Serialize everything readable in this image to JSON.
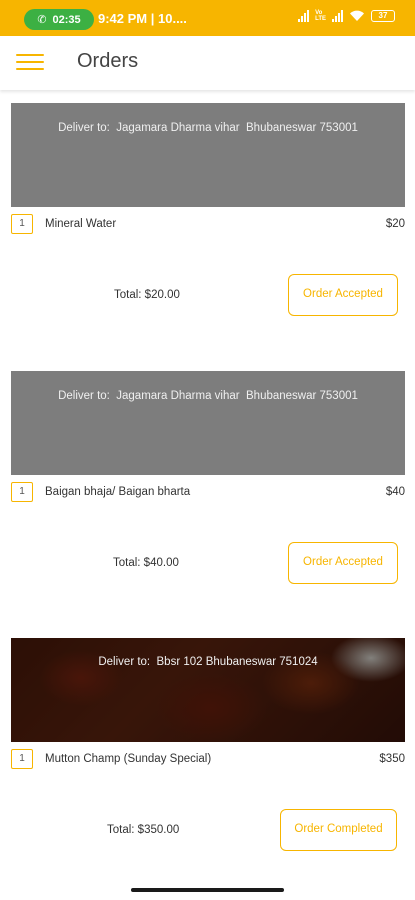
{
  "status_bar": {
    "call_time": "02:35",
    "time": "9:42 PM | 10....",
    "network_label_1": "Vo",
    "network_label_2": "LTE",
    "battery": "37"
  },
  "app_bar": {
    "menu_icon": "hamburger-menu-icon",
    "title": "Orders"
  },
  "orders": [
    {
      "deliver_text": "Deliver to:  Jagamara Dharma vihar  Bhubaneswar 753001",
      "items": [
        {
          "qty": "1",
          "name": "Mineral Water",
          "price": "$20"
        }
      ],
      "total": "Total: $20.00",
      "status": "Order Accepted"
    },
    {
      "deliver_text": "Deliver to:  Jagamara Dharma vihar  Bhubaneswar 753001",
      "items": [
        {
          "qty": "1",
          "name": "Baigan bhaja/ Baigan bharta",
          "price": "$40"
        }
      ],
      "total": "Total: $40.00",
      "status": "Order Accepted"
    },
    {
      "deliver_text": "Deliver to:  Bbsr 102 Bhubaneswar 751024",
      "items": [
        {
          "qty": "1",
          "name": "Mutton Champ (Sunday Special)",
          "price": "$350"
        }
      ],
      "total": "Total: $350.00",
      "status": "Order Completed"
    }
  ],
  "colors": {
    "accent": "#f7b500",
    "call_pill": "#3cb043",
    "banner_gray": "#7d7d7d"
  }
}
